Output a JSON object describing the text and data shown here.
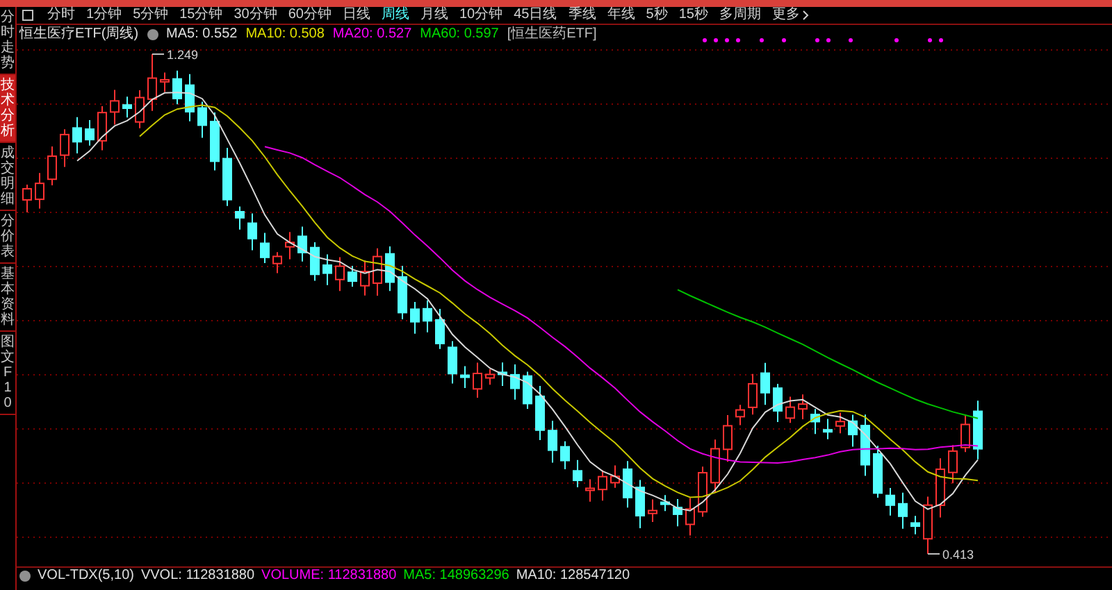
{
  "side_tabs": [
    {
      "label": "分时走势",
      "selected": false
    },
    {
      "label": "技术分析",
      "selected": true
    },
    {
      "label": "成交明细",
      "selected": false
    },
    {
      "label": "分价表",
      "selected": false
    },
    {
      "label": "基本资料",
      "selected": false
    },
    {
      "label": "图文F10",
      "selected": false
    }
  ],
  "period_tabs": [
    {
      "label": "分时",
      "selected": false
    },
    {
      "label": "1分钟",
      "selected": false
    },
    {
      "label": "5分钟",
      "selected": false
    },
    {
      "label": "15分钟",
      "selected": false
    },
    {
      "label": "30分钟",
      "selected": false
    },
    {
      "label": "60分钟",
      "selected": false
    },
    {
      "label": "日线",
      "selected": false
    },
    {
      "label": "周线",
      "selected": true
    },
    {
      "label": "月线",
      "selected": false
    },
    {
      "label": "10分钟",
      "selected": false
    },
    {
      "label": "45日线",
      "selected": false
    },
    {
      "label": "季线",
      "selected": false
    },
    {
      "label": "年线",
      "selected": false
    },
    {
      "label": "5秒",
      "selected": false
    },
    {
      "label": "15秒",
      "selected": false
    },
    {
      "label": "多周期",
      "selected": false
    }
  ],
  "more_button": "更多",
  "info_line": {
    "title": "恒生医疗ETF(周线)",
    "indicators": [
      {
        "label": "MA5: 0.552",
        "color": "#e0e0e0"
      },
      {
        "label": "MA10: 0.508",
        "color": "#e0e000"
      },
      {
        "label": "MA20: 0.527",
        "color": "#ff00ff"
      },
      {
        "label": "MA60: 0.597",
        "color": "#00e000"
      }
    ],
    "tag": "[恒生医药ETF]"
  },
  "chart": {
    "high_label": "1.249",
    "low_label": "0.413"
  },
  "volume_line": {
    "name": "VOL-TDX(5,10)",
    "indicators": [
      {
        "label": "VVOL: 112831880",
        "color": "#e0e0e0"
      },
      {
        "label": "VOLUME: 112831880",
        "color": "#ff00ff"
      },
      {
        "label": "MA5: 148963296",
        "color": "#00e000"
      },
      {
        "label": "MA10: 128547120",
        "color": "#e0e0e0"
      }
    ]
  }
}
